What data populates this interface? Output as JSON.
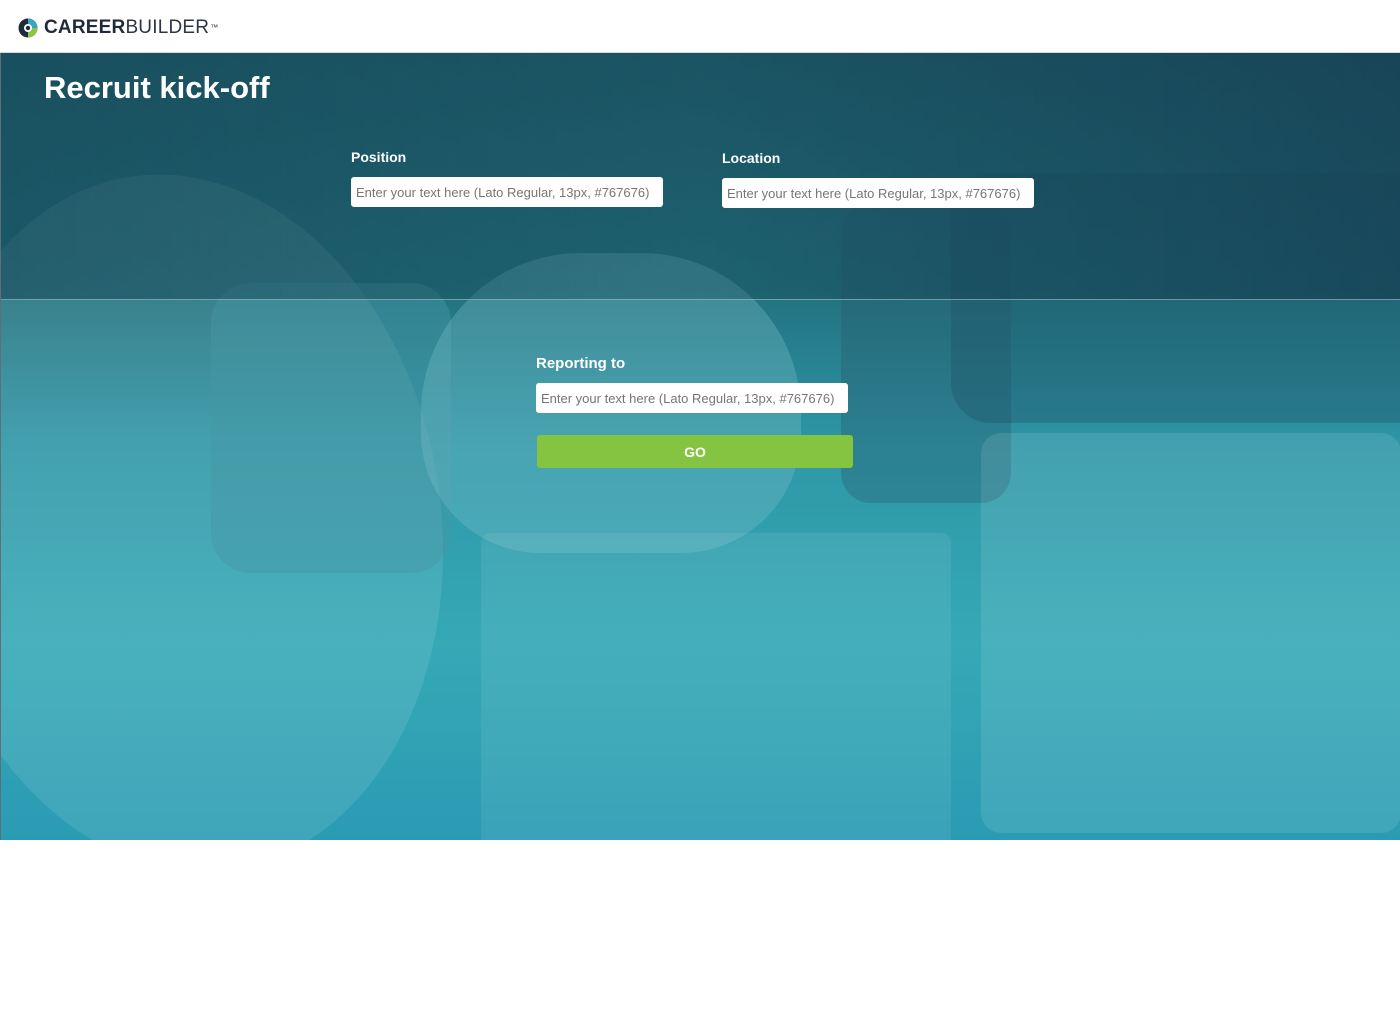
{
  "header": {
    "logo_icon": "careerbuilder-globe-icon",
    "logo_text_bold": "CAREER",
    "logo_text_light": "BUILDER",
    "logo_tm": "™"
  },
  "main": {
    "title": "Recruit kick-off",
    "fields": {
      "position": {
        "label": "Position",
        "value": "",
        "placeholder": "Enter your text here (Lato Regular, 13px, #767676)"
      },
      "location": {
        "label": "Location",
        "value": "",
        "placeholder": "Enter your text here (Lato Regular, 13px, #767676)"
      },
      "reporting_to": {
        "label": "Reporting to",
        "value": "",
        "placeholder": "Enter your text here (Lato Regular, 13px, #767676)"
      }
    },
    "go_label": "GO"
  },
  "colors": {
    "accent_button": "#84c441",
    "hero_teal": "#2e97a6",
    "placeholder_text": "#767676"
  }
}
